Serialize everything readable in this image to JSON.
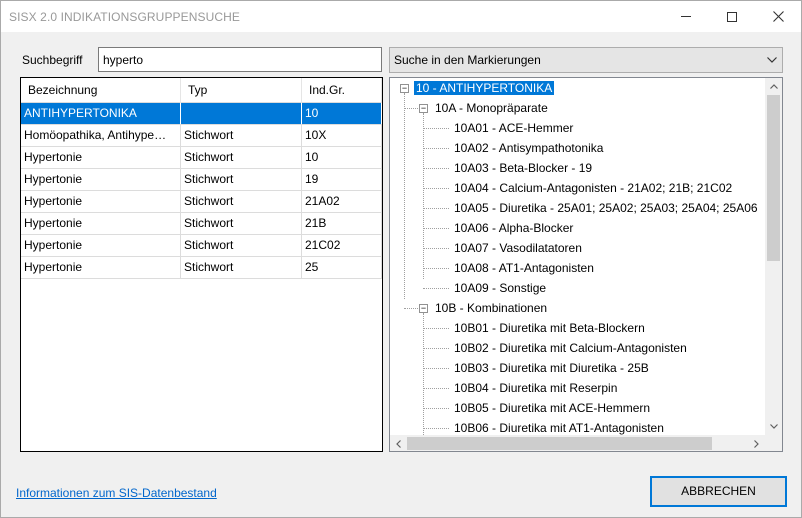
{
  "window": {
    "title": "SISX 2.0 INDIKATIONSGRUPPENSUCHE"
  },
  "search": {
    "label": "Suchbegriff",
    "value": "hyperto"
  },
  "results": {
    "columns": [
      "Bezeichnung",
      "Typ",
      "Ind.Gr."
    ],
    "rows": [
      [
        "ANTIHYPERTONIKA",
        "",
        "10"
      ],
      [
        "Homöopathika, Antihype…",
        "Stichwort",
        "10X"
      ],
      [
        "Hypertonie",
        "Stichwort",
        "10"
      ],
      [
        "Hypertonie",
        "Stichwort",
        "19"
      ],
      [
        "Hypertonie",
        "Stichwort",
        "21A02"
      ],
      [
        "Hypertonie",
        "Stichwort",
        "21B"
      ],
      [
        "Hypertonie",
        "Stichwort",
        "21C02"
      ],
      [
        "Hypertonie",
        "Stichwort",
        "25"
      ]
    ],
    "selected_row": 0
  },
  "scope": {
    "selected": "Suche in den Markierungen"
  },
  "tree": {
    "root": "10 - ANTIHYPERTONIKA",
    "groups": [
      {
        "label": "10A - Monopräparate",
        "children": [
          "10A01 - ACE-Hemmer",
          "10A02 - Antisympathotonika",
          "10A03 - Beta-Blocker - 19",
          "10A04 - Calcium-Antagonisten - 21A02; 21B; 21C02",
          "10A05 - Diuretika - 25A01; 25A02; 25A03; 25A04; 25A06",
          "10A06 - Alpha-Blocker",
          "10A07 - Vasodilatatoren",
          "10A08 - AT1-Antagonisten",
          "10A09 - Sonstige"
        ]
      },
      {
        "label": "10B - Kombinationen",
        "children": [
          "10B01 - Diuretika mit Beta-Blockern",
          "10B02 - Diuretika mit Calcium-Antagonisten",
          "10B03 - Diuretika mit Diuretika - 25B",
          "10B04 - Diuretika mit Reserpin",
          "10B05 - Diuretika mit ACE-Hemmern",
          "10B06 - Diuretika mit AT1-Antagonisten"
        ]
      }
    ]
  },
  "footer": {
    "info_link": "Informationen zum SIS-Datenbestand",
    "cancel_button": "ABBRECHEN"
  }
}
